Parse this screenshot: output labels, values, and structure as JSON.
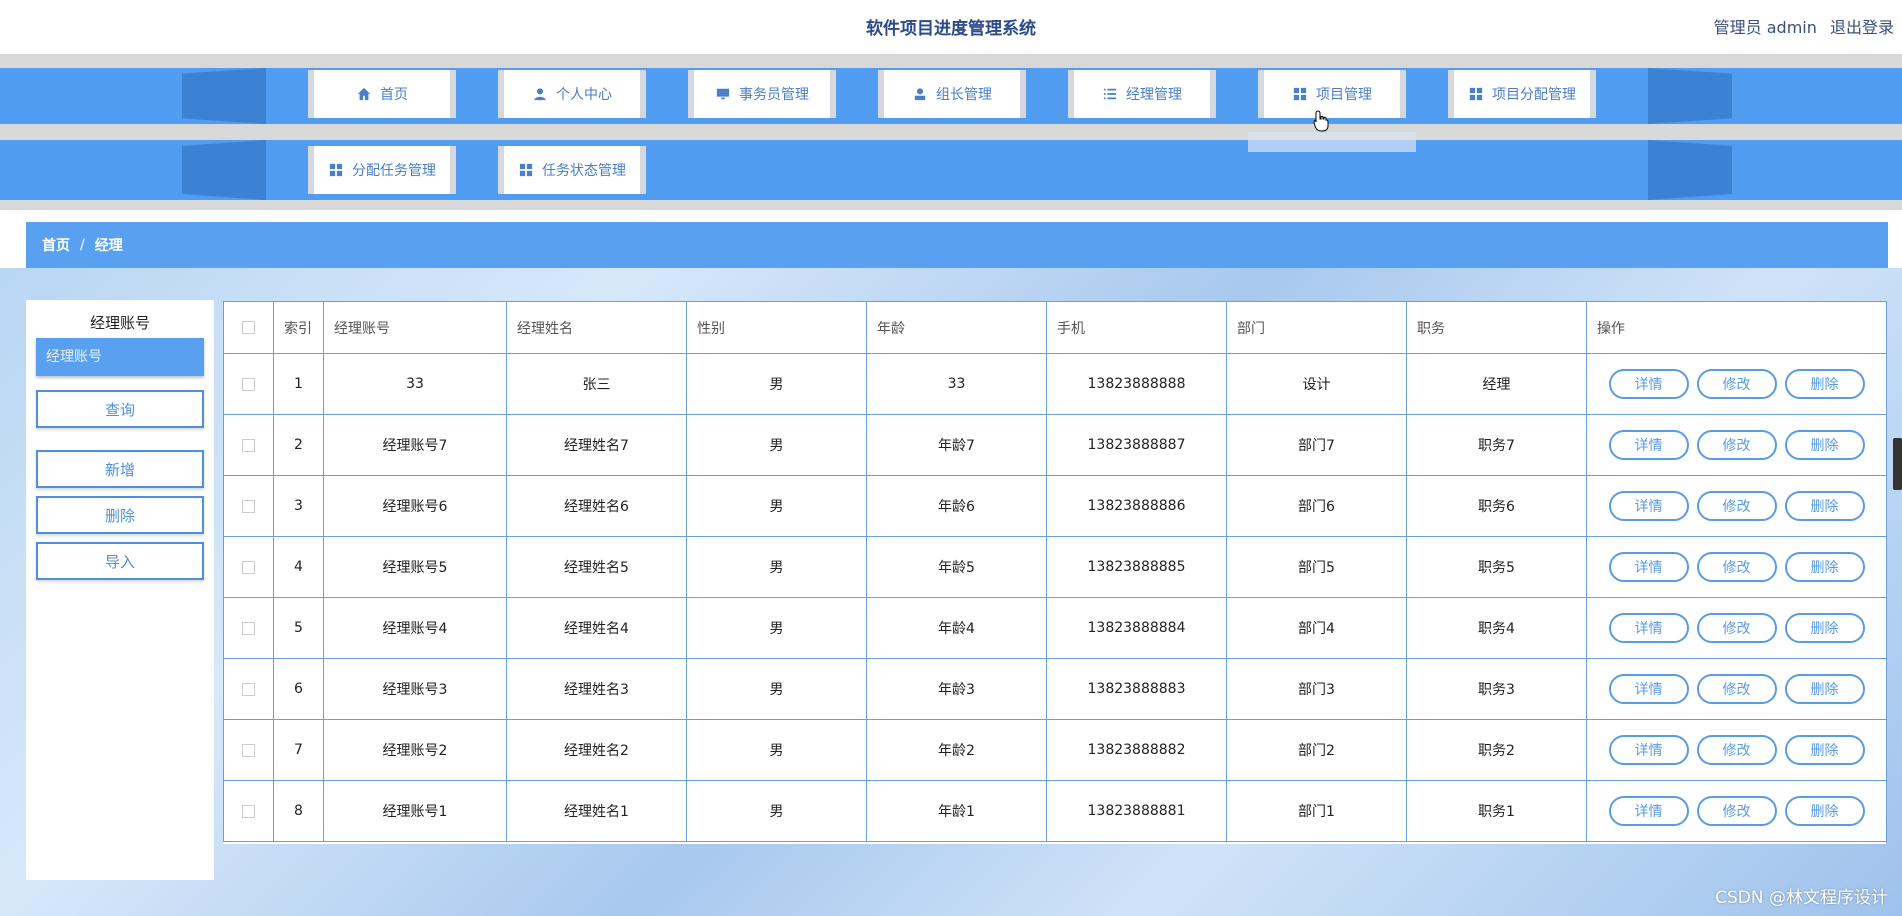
{
  "header": {
    "title": "软件项目进度管理系统",
    "user_label": "管理员 admin",
    "logout_label": "退出登录"
  },
  "nav": {
    "row1": [
      {
        "label": "首页",
        "icon": "home-icon"
      },
      {
        "label": "个人中心",
        "icon": "user-icon"
      },
      {
        "label": "事务员管理",
        "icon": "monitor-icon"
      },
      {
        "label": "组长管理",
        "icon": "person-icon"
      },
      {
        "label": "经理管理",
        "icon": "list-icon"
      },
      {
        "label": "项目管理",
        "icon": "grid-icon"
      },
      {
        "label": "项目分配管理",
        "icon": "grid-icon"
      }
    ],
    "row2": [
      {
        "label": "分配任务管理",
        "icon": "grid-icon"
      },
      {
        "label": "任务状态管理",
        "icon": "grid-icon"
      }
    ]
  },
  "breadcrumb": {
    "home": "首页",
    "separator": "/",
    "current": "经理"
  },
  "search": {
    "field_label": "经理账号",
    "placeholder": "经理账号",
    "query_label": "查询",
    "add_label": "新增",
    "delete_label": "删除",
    "import_label": "导入"
  },
  "table": {
    "columns": [
      "索引",
      "经理账号",
      "经理姓名",
      "性别",
      "年龄",
      "手机",
      "部门",
      "职务",
      "操作"
    ],
    "rows": [
      {
        "index": "1",
        "account": "33",
        "name": "张三",
        "gender": "男",
        "age": "33",
        "phone": "13823888888",
        "dept": "设计",
        "title": "经理"
      },
      {
        "index": "2",
        "account": "经理账号7",
        "name": "经理姓名7",
        "gender": "男",
        "age": "年龄7",
        "phone": "13823888887",
        "dept": "部门7",
        "title": "职务7"
      },
      {
        "index": "3",
        "account": "经理账号6",
        "name": "经理姓名6",
        "gender": "男",
        "age": "年龄6",
        "phone": "13823888886",
        "dept": "部门6",
        "title": "职务6"
      },
      {
        "index": "4",
        "account": "经理账号5",
        "name": "经理姓名5",
        "gender": "男",
        "age": "年龄5",
        "phone": "13823888885",
        "dept": "部门5",
        "title": "职务5"
      },
      {
        "index": "5",
        "account": "经理账号4",
        "name": "经理姓名4",
        "gender": "男",
        "age": "年龄4",
        "phone": "13823888884",
        "dept": "部门4",
        "title": "职务4"
      },
      {
        "index": "6",
        "account": "经理账号3",
        "name": "经理姓名3",
        "gender": "男",
        "age": "年龄3",
        "phone": "13823888883",
        "dept": "部门3",
        "title": "职务3"
      },
      {
        "index": "7",
        "account": "经理账号2",
        "name": "经理姓名2",
        "gender": "男",
        "age": "年龄2",
        "phone": "13823888882",
        "dept": "部门2",
        "title": "职务2"
      },
      {
        "index": "8",
        "account": "经理账号1",
        "name": "经理姓名1",
        "gender": "男",
        "age": "年龄1",
        "phone": "13823888881",
        "dept": "部门1",
        "title": "职务1"
      }
    ],
    "actions": {
      "detail": "详情",
      "edit": "修改",
      "delete": "删除"
    }
  },
  "watermark": "CSDN @林文程序设计",
  "colors": {
    "nav_blue": "#4f9cf0",
    "nav_dark": "#3b82d4",
    "title_text": "#2c4a8a",
    "button_blue": "#5a9be6"
  }
}
